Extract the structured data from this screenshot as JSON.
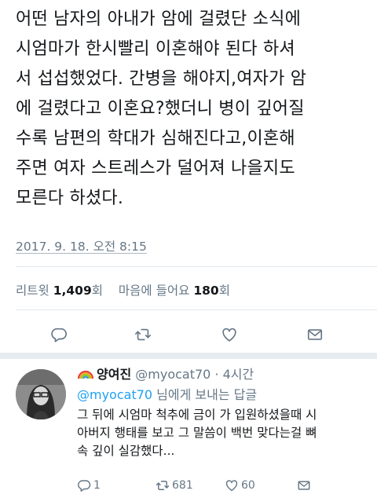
{
  "tweet": {
    "text": "어떤 남자의 아내가 암에 걸렸단 소식에\n시엄마가 한시빨리 이혼해야 된다 하셔\n서 섭섭했었다. 간병을 해야지,여자가 암\n에 걸렸다고 이혼요?했더니 병이 깊어질\n수록 남편의 학대가 심해진다고,이혼해\n주면 여자 스트레스가 덜어져 나을지도\n모른다 하셨다.",
    "timestamp": "2017. 9. 18. 오전 8:15",
    "retweet_label": "리트윗",
    "retweet_count": "1,409",
    "retweet_unit": "회",
    "like_label": "마음에 들어요",
    "like_count": "180",
    "like_unit": "회"
  },
  "actions": {
    "reply_icon": "reply-icon",
    "retweet_icon": "retweet-icon",
    "like_icon": "heart-icon",
    "dm_icon": "mail-icon"
  },
  "reply": {
    "name": "양여진",
    "handle": "@myocat70",
    "sep": " · ",
    "time": "4시간",
    "replying_handle": "@myocat70",
    "replying_suffix": " 님에게 보내는 답글",
    "text": "그 뒤에 시엄마 척추에 금이 가 입원하셨을때 시\n아버지 행태를 보고 그 말씀이 백번 맞다는걸 뼈\n속 깊이 실감했다...",
    "reply_count": "1",
    "retweet_count": "681",
    "like_count": "60"
  },
  "colors": {
    "text": "#14171a",
    "secondary": "#657786",
    "link": "#1da1f2",
    "divider": "#e1e8ed"
  }
}
